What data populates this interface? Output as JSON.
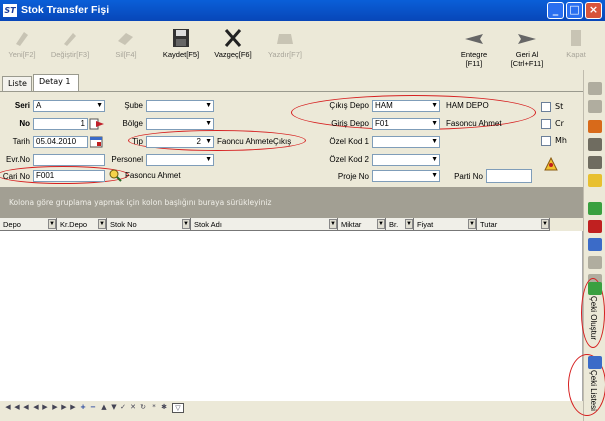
{
  "window": {
    "title": "Stok Transfer Fişi",
    "app_icon_text": "ST"
  },
  "toolbar": {
    "new": "Yeni[F2]",
    "edit": "Değiştir[F3]",
    "delete": "Sil[F4]",
    "save": "Kaydet[F5]",
    "cancel": "Vazgeç[F6]",
    "print": "Yazdır[F7]",
    "integrate_1": "Entegre",
    "integrate_2": "[F11]",
    "undo_1": "Geri Al",
    "undo_2": "[Ctrl+F11]",
    "close": "Kapat"
  },
  "tabs": [
    {
      "label": "Liste"
    },
    {
      "label": "Detay 1"
    }
  ],
  "form": {
    "seri_label": "Seri",
    "seri_value": "A",
    "no_label": "No",
    "no_value": "1",
    "tarih_label": "Tarih",
    "tarih_value": "05.04.2010",
    "evrno_label": "Evr.No",
    "evrno_value": "",
    "carino_label": "Cari No",
    "carino_value": "F001",
    "cari_name": "Fasoncu Ahmet",
    "sube_label": "Şube",
    "bolge_label": "Bölge",
    "tip_label": "Tip",
    "tip_value": "2",
    "tip_desc": "Faoncu AhmeteÇıkış",
    "personel_label": "Personel",
    "cikis_depo_label": "Çıkış Depo",
    "cikis_depo_value": "HAM",
    "cikis_depo_name": "HAM DEPO",
    "giris_depo_label": "Giriş Depo",
    "giris_depo_value": "F01",
    "giris_depo_name": "Fasoncu Ahmet",
    "ozel1_label": "Özel Kod 1",
    "ozel2_label": "Özel Kod 2",
    "proje_label": "Proje No",
    "parti_label": "Parti No",
    "st_label": "St",
    "cr_label": "Cr",
    "mh_label": "Mh"
  },
  "grid": {
    "group_hint": "Kolona göre gruplama yapmak için kolon başlığını buraya sürükleyiniz",
    "columns": [
      "Depo",
      "Kr.Depo",
      "Stok No",
      "Stok Adı",
      "Miktar",
      "Br.",
      "Fiyat",
      "Tutar"
    ]
  },
  "rightbar": {
    "cekiolustur": "Çeki Oluştur",
    "cekilistesi": "Çeki Listesi"
  },
  "colors": {
    "title_blue": "#0a5fd8",
    "red_ellipse": "#d62020",
    "group_gray": "#a29f93"
  }
}
